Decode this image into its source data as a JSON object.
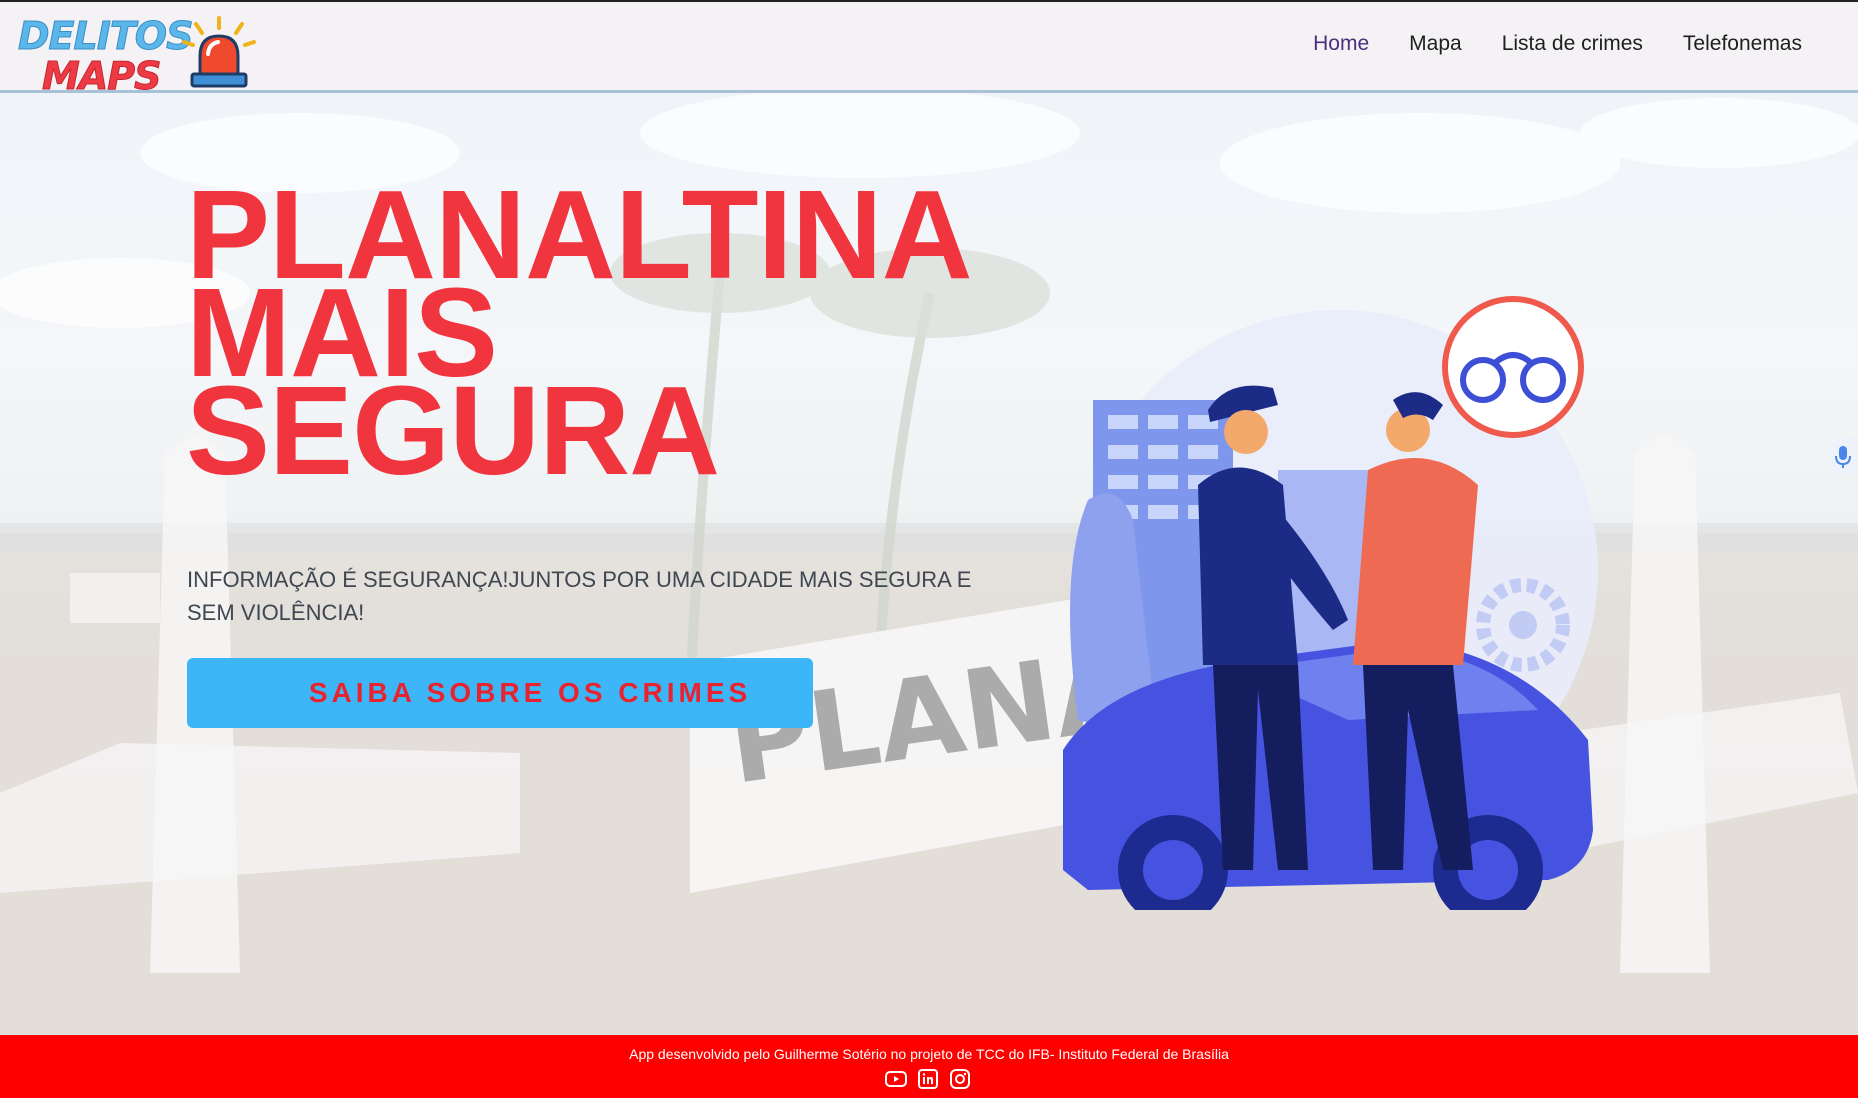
{
  "header": {
    "logo": {
      "word1": "DELITOS",
      "word2": "MAPS",
      "siren_icon": "siren-icon"
    },
    "nav": [
      {
        "label": "Home",
        "active": true
      },
      {
        "label": "Mapa",
        "active": false
      },
      {
        "label": "Lista de crimes",
        "active": false
      },
      {
        "label": "Telefonemas",
        "active": false
      }
    ]
  },
  "hero": {
    "title_lines": [
      "PLANALTINA",
      "MAIS",
      "SEGURA"
    ],
    "subtitle": "INFORMAÇÃO É SEGURANÇA!JUNTOS POR UMA CIDADE MAIS SEGURA E SEM VIOLÊNCIA!",
    "cta_label": "SAIBA SOBRE OS CRIMES",
    "background_sign_text": "PLANALT",
    "illustration_icon": "police-arrest-illustration"
  },
  "footer": {
    "text": "App desenvolvido pelo Guilherme Sotério no projeto de TCC do IFB- Instituto Federal de Brasília",
    "socials": [
      "youtube-icon",
      "linkedin-icon",
      "instagram-icon"
    ]
  },
  "colors": {
    "title_red": "#f1353f",
    "cta_blue": "#3db6f7",
    "cta_text_red": "#e8232f",
    "footer_red": "#fe0000",
    "nav_active": "#4a2f7c"
  }
}
